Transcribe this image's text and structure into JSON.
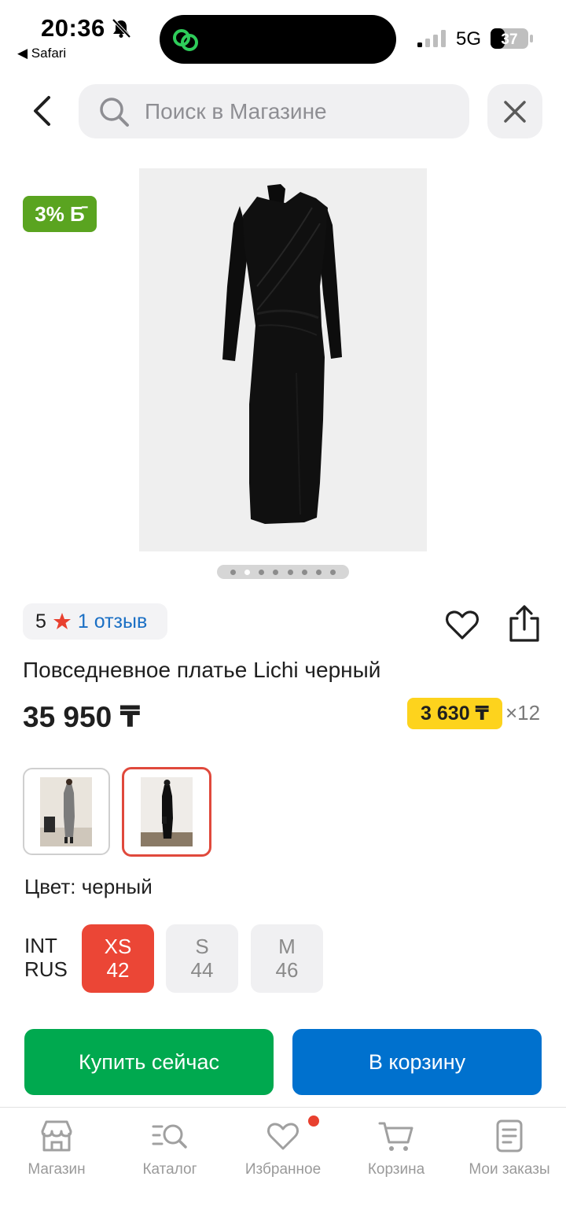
{
  "status_bar": {
    "time": "20:36",
    "back_app": "◀ Safari",
    "network": "5G",
    "battery": "37"
  },
  "search": {
    "placeholder": "Поиск в Магазине"
  },
  "product": {
    "bonus_badge": "3% Б̄",
    "image_count": 8,
    "active_image_index": 1,
    "rating": "5",
    "reviews": "1 отзыв",
    "title": "Повседневное платье Lichi черный",
    "price": "35 950 ₸",
    "installment_price": "3 630 ₸",
    "installment_months": "×12",
    "color_label": "Цвет: черный",
    "colors": [
      {
        "name": "серый",
        "selected": false
      },
      {
        "name": "черный",
        "selected": true
      }
    ],
    "size_system": {
      "int": "INT",
      "rus": "RUS"
    },
    "sizes": [
      {
        "int": "XS",
        "rus": "42",
        "selected": true
      },
      {
        "int": "S",
        "rus": "44",
        "selected": false
      },
      {
        "int": "M",
        "rus": "46",
        "selected": false
      }
    ]
  },
  "actions": {
    "buy_now": "Купить сейчас",
    "add_to_cart": "В корзину"
  },
  "tabbar": {
    "tabs": [
      {
        "label": "Магазин",
        "icon": "store-icon"
      },
      {
        "label": "Каталог",
        "icon": "catalog-search-icon"
      },
      {
        "label": "Избранное",
        "icon": "heart-icon",
        "has_notification": true
      },
      {
        "label": "Корзина",
        "icon": "cart-icon"
      },
      {
        "label": "Мои заказы",
        "icon": "orders-icon"
      }
    ]
  },
  "colors": {
    "accent_red": "#eb4636",
    "buy_green": "#00a94f",
    "cart_blue": "#0071ce",
    "bonus_green": "#5aa420",
    "installment_yellow": "#fdd31d",
    "link_blue": "#1a6fc4"
  }
}
